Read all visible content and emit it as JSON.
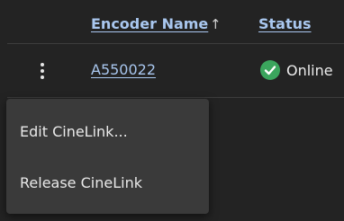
{
  "table": {
    "columns": {
      "encoder_name": "Encoder Name",
      "status": "Status"
    },
    "sort": {
      "column": "encoder_name",
      "direction": "ascending",
      "icon": "arrow-up-icon",
      "glyph": "↑"
    },
    "rows": [
      {
        "encoder_name": "A550022",
        "status": "Online",
        "status_icon": "check-circle-icon",
        "status_color": "#3ba55d"
      }
    ]
  },
  "row_actions_icon": "kebab-menu-icon",
  "context_menu": {
    "items": [
      {
        "label": "Edit CineLink..."
      },
      {
        "label": "Release CineLink"
      }
    ]
  },
  "colors": {
    "background": "#232323",
    "link": "#a9c7ef",
    "menu_background": "#3a3a3a",
    "online": "#3ba55d"
  }
}
